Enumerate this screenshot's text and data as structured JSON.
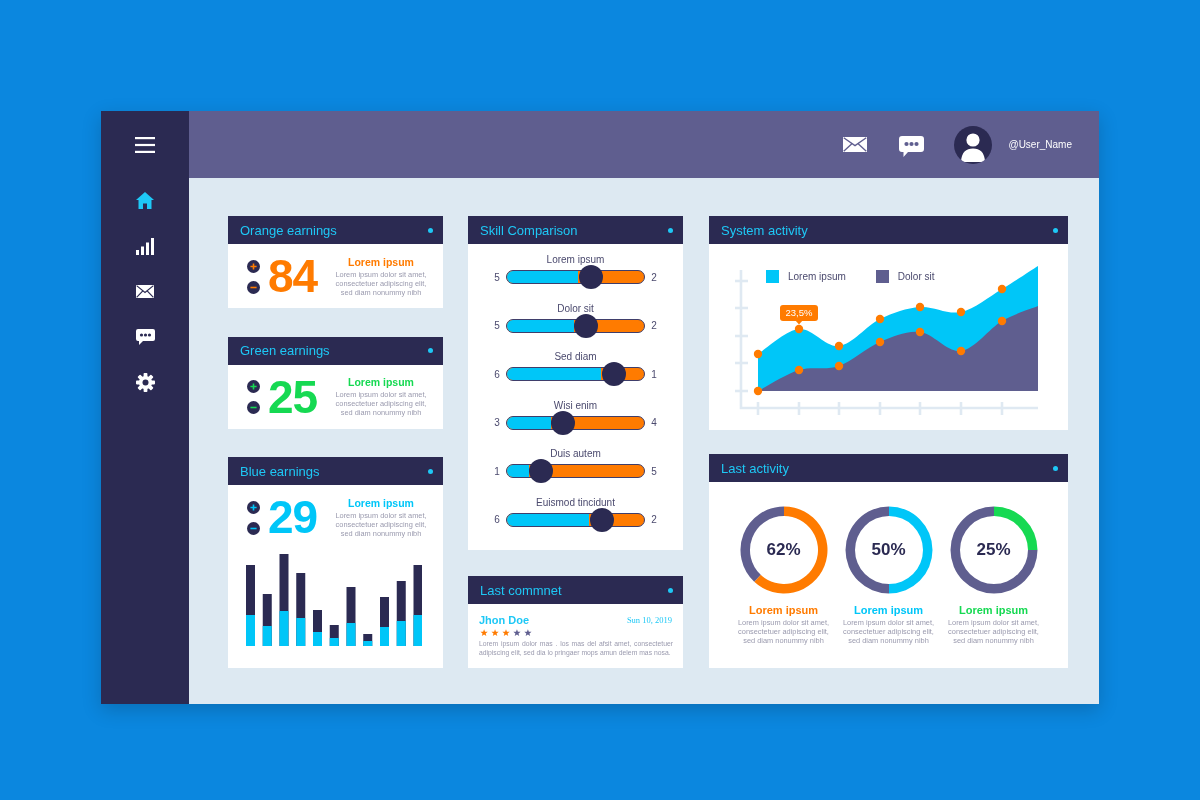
{
  "sidebar": {
    "items": [
      {
        "selected": true
      },
      {
        "selected": false
      },
      {
        "selected": false
      },
      {
        "selected": false
      },
      {
        "selected": false
      }
    ]
  },
  "header": {
    "user_name": "@User_Name"
  },
  "earnings": [
    {
      "title": "Orange earnings",
      "kind": "plain",
      "value": "84",
      "color": "#ff7b00",
      "heading": "Lorem ipsum",
      "text": "Lorem ipsum dolor sit amet, consectetuer adipiscing elit, sed diam nonummy nibh"
    },
    {
      "title": "Green earnings",
      "kind": "plain",
      "value": "25",
      "color": "#16d952",
      "heading": "Lorem ipsum",
      "text": "Lorem ipsum dolor sit amet, consectetuer adipiscing elit, sed diam nonummy nibh"
    },
    {
      "title": "Blue earnings",
      "kind": "bars",
      "value": "29",
      "color": "#00c6f8",
      "heading": "Lorem ipsum",
      "text": "Lorem ipsum dolor sit amet, consectetuer adipiscing elit, sed diam nonummy nibh"
    }
  ],
  "skill_comparison": {
    "title": "Skill Comparison",
    "sliders": [
      {
        "label": "Lorem ipsum",
        "left_value": "5",
        "right_value": "2",
        "level": 0.61
      },
      {
        "label": "Dolor sit",
        "left_value": "5",
        "right_value": "2",
        "level": 0.58
      },
      {
        "label": "Sed diam",
        "left_value": "6",
        "right_value": "1",
        "level": 0.78
      },
      {
        "label": "Wisi enim",
        "left_value": "3",
        "right_value": "4",
        "level": 0.41
      },
      {
        "label": "Duis autem",
        "left_value": "1",
        "right_value": "5",
        "level": 0.25
      },
      {
        "label": "Euismod tincidunt",
        "left_value": "6",
        "right_value": "2",
        "level": 0.69
      }
    ]
  },
  "last_comment": {
    "title": "Last commnet",
    "author": "Jhon Doe",
    "date": "Sun 10, 2019",
    "stars": 3,
    "text": "Lorem ipsum dolor mas . los mas del afsit amet, consectetuer adipiscing elit, sed dia lo pringaer mops amun delem mas nosa."
  },
  "system_activity": {
    "title": "System activity",
    "legend": [
      {
        "label": "Lorem ipsum",
        "color": "#00c6f8"
      },
      {
        "label": "Dolor sit",
        "color": "#5f5e8f"
      }
    ],
    "callout": "23,5%"
  },
  "last_activity": {
    "title": "Last activity",
    "items": [
      {
        "value": "62%",
        "chart_data": {
          "type": "donut",
          "values": [
            62,
            38
          ],
          "colors": [
            "#ff7b00",
            "#5f5e8f"
          ]
        },
        "heading": "Lorem ipsum",
        "text": "Lorem ipsum dolor sit amet, consectetuer adipiscing elit, sed diam nonummy nibh"
      },
      {
        "value": "50%",
        "chart_data": {
          "type": "donut",
          "values": [
            50,
            50
          ],
          "colors": [
            "#00c6f8",
            "#5f5e8f"
          ]
        },
        "heading": "Lorem ipsum",
        "text": "Lorem ipsum dolor sit amet, consectetuer adipiscing elit, sed diam nonummy nibh"
      },
      {
        "value": "25%",
        "chart_data": {
          "type": "donut",
          "values": [
            25,
            75
          ],
          "colors": [
            "#16d952",
            "#5f5e8f"
          ]
        },
        "heading": "Lorem ipsum",
        "text": "Lorem ipsum dolor sit amet, consectetuer adipiscing elit, sed diam nonummy nibh"
      }
    ]
  }
}
